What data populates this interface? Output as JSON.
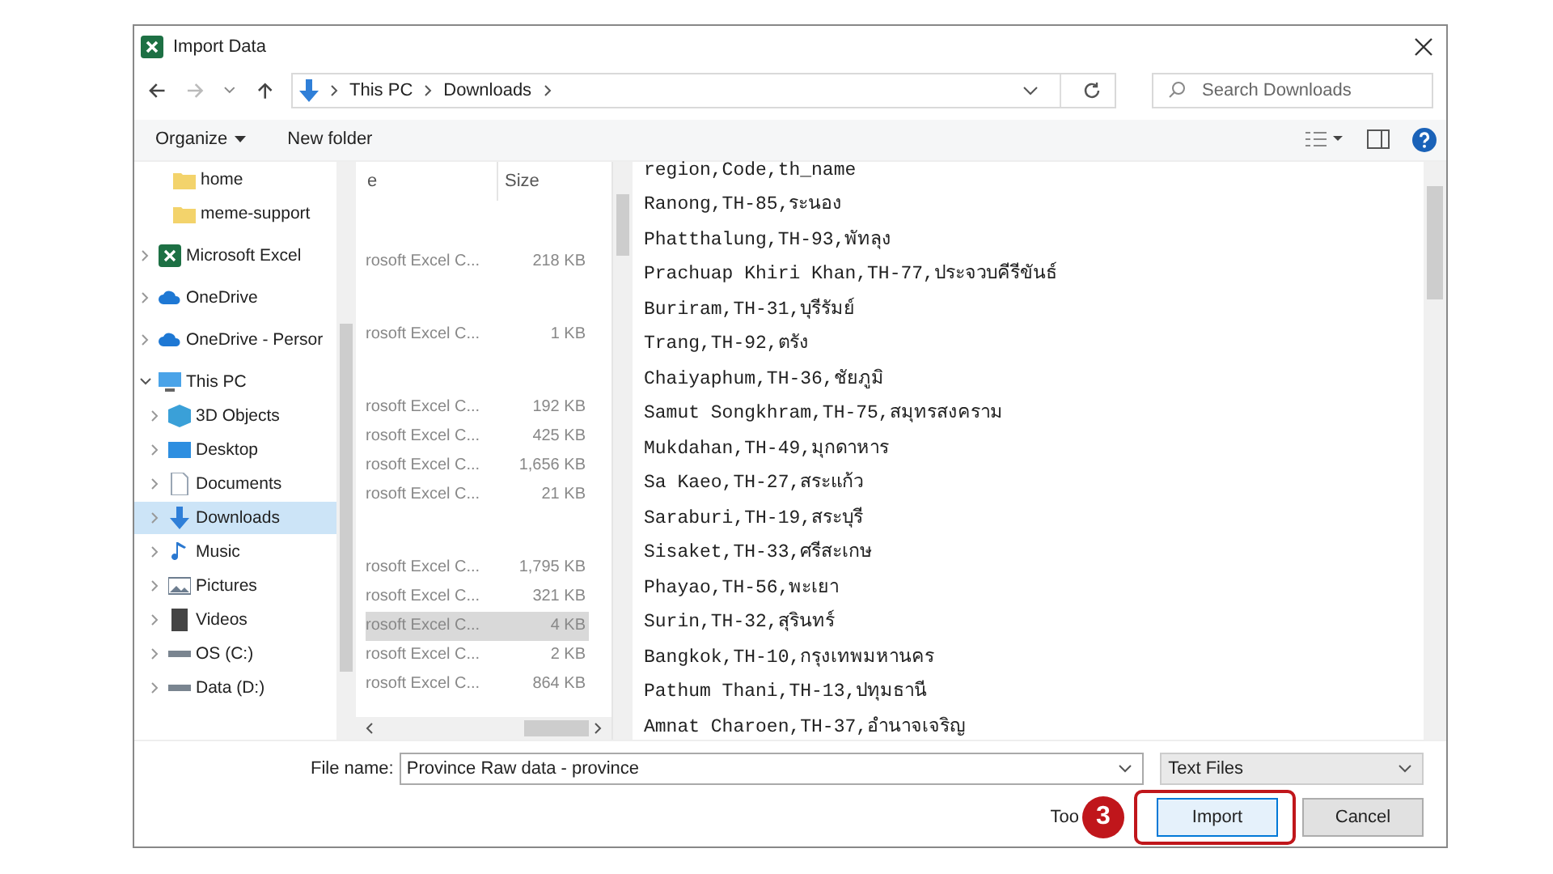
{
  "window": {
    "title": "Import Data"
  },
  "address": {
    "crumbs": [
      "This PC",
      "Downloads"
    ]
  },
  "search": {
    "placeholder": "Search Downloads"
  },
  "toolbar": {
    "organize": "Organize",
    "new_folder": "New folder"
  },
  "sidebar": {
    "items": [
      {
        "label": "home",
        "kind": "child",
        "selected": false
      },
      {
        "label": "meme-support",
        "kind": "child",
        "selected": false
      },
      {
        "label": "Microsoft Excel",
        "kind": "root",
        "selected": false
      },
      {
        "label": "OneDrive",
        "kind": "root",
        "selected": false
      },
      {
        "label": "OneDrive - Persor",
        "kind": "root",
        "selected": false
      },
      {
        "label": "This PC",
        "kind": "root",
        "expanded": true,
        "selected": false
      },
      {
        "label": "3D Objects",
        "kind": "child",
        "selected": false
      },
      {
        "label": "Desktop",
        "kind": "child",
        "selected": false
      },
      {
        "label": "Documents",
        "kind": "child",
        "selected": false
      },
      {
        "label": "Downloads",
        "kind": "child",
        "selected": true
      },
      {
        "label": "Music",
        "kind": "child",
        "selected": false
      },
      {
        "label": "Pictures",
        "kind": "child",
        "selected": false
      },
      {
        "label": "Videos",
        "kind": "child",
        "selected": false
      },
      {
        "label": "OS (C:)",
        "kind": "child",
        "selected": false
      },
      {
        "label": "Data (D:)",
        "kind": "child",
        "selected": false
      }
    ]
  },
  "table": {
    "columns": [
      "e",
      "Size"
    ],
    "rows": [
      {
        "kind": "blank"
      },
      {
        "kind": "file",
        "type": "rosoft Excel C...",
        "size": "218 KB",
        "selected": false
      },
      {
        "kind": "blank"
      },
      {
        "kind": "file",
        "type": "rosoft Excel C...",
        "size": "1 KB",
        "selected": false
      },
      {
        "kind": "blank"
      },
      {
        "kind": "file",
        "type": "rosoft Excel C...",
        "size": "192 KB",
        "selected": false
      },
      {
        "kind": "file",
        "type": "rosoft Excel C...",
        "size": "425 KB",
        "selected": false
      },
      {
        "kind": "file",
        "type": "rosoft Excel C...",
        "size": "1,656 KB",
        "selected": false
      },
      {
        "kind": "file",
        "type": "rosoft Excel C...",
        "size": "21 KB",
        "selected": false
      },
      {
        "kind": "blank"
      },
      {
        "kind": "file",
        "type": "rosoft Excel C...",
        "size": "1,795 KB",
        "selected": false
      },
      {
        "kind": "file",
        "type": "rosoft Excel C...",
        "size": "321 KB",
        "selected": false
      },
      {
        "kind": "file",
        "type": "rosoft Excel C...",
        "size": "4 KB",
        "selected": true
      },
      {
        "kind": "file",
        "type": "rosoft Excel C...",
        "size": "2 KB",
        "selected": false
      },
      {
        "kind": "file",
        "type": "rosoft Excel C...",
        "size": "864 KB",
        "selected": false
      }
    ]
  },
  "preview": {
    "lines": [
      "region,Code,th_name",
      "Ranong,TH-85,ระนอง",
      "Phatthalung,TH-93,พัทลุง",
      "Prachuap Khiri Khan,TH-77,ประจวบคีรีขันธ์",
      "Buriram,TH-31,บุรีรัมย์",
      "Trang,TH-92,ตรัง",
      "Chaiyaphum,TH-36,ชัยภูมิ",
      "Samut Songkhram,TH-75,สมุทรสงคราม",
      "Mukdahan,TH-49,มุกดาหาร",
      "Sa Kaeo,TH-27,สระแก้ว",
      "Saraburi,TH-19,สระบุรี",
      "Sisaket,TH-33,ศรีสะเกษ",
      "Phayao,TH-56,พะเยา",
      "Surin,TH-32,สุรินทร์",
      "Bangkok,TH-10,กรุงเทพมหานคร",
      "Pathum Thani,TH-13,ปทุมธานี",
      "Amnat Charoen,TH-37,อำนาจเจริญ"
    ]
  },
  "footer": {
    "file_name_label": "File name:",
    "file_name": "Province Raw data - province",
    "filter": "Text Files",
    "tools": "Too",
    "step_badge": "3",
    "import": "Import",
    "cancel": "Cancel",
    "import_highlighted": true
  }
}
